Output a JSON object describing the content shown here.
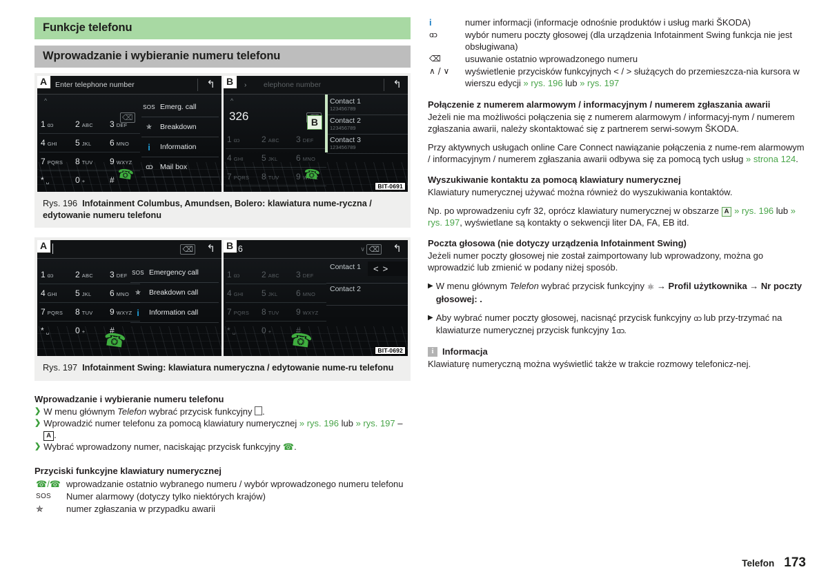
{
  "headers": {
    "green": "Funkcje telefonu",
    "grey": "Wprowadzanie i wybieranie numeru telefonu"
  },
  "figure196": {
    "tagA": "A",
    "tagB": "B",
    "tagB_inner": "B",
    "bit": "BIT-0691",
    "caption_rys": "Rys. 196",
    "caption_text": "Infotainment Columbus, Amundsen, Bolero: klawiatura nume-ryczna / edytowanie numeru telefonu",
    "screenA": {
      "title": "Enter telephone number",
      "keys": [
        {
          "digit": "1",
          "sub": "ɑɔ"
        },
        {
          "digit": "2",
          "sub": "ABC"
        },
        {
          "digit": "3",
          "sub": "DEF"
        },
        {
          "digit": "4",
          "sub": "GHI"
        },
        {
          "digit": "5",
          "sub": "JKL"
        },
        {
          "digit": "6",
          "sub": "MNO"
        },
        {
          "digit": "7",
          "sub": "PQRS"
        },
        {
          "digit": "8",
          "sub": "TUV"
        },
        {
          "digit": "9",
          "sub": "WXYZ"
        },
        {
          "digit": "*",
          "sub": "␣"
        },
        {
          "digit": "0",
          "sub": "+"
        },
        {
          "digit": "#",
          "sub": ""
        }
      ],
      "menu": [
        {
          "icon": "sos-icon",
          "glyph": "SOS",
          "label": "Emerg. call"
        },
        {
          "icon": "wrench-icon",
          "glyph": "🔧",
          "label": "Breakdown"
        },
        {
          "icon": "info-icon",
          "glyph": "i",
          "label": "Information"
        },
        {
          "icon": "voicemail-icon",
          "glyph": "ɑɔ",
          "label": "Mail box"
        }
      ]
    },
    "screenB": {
      "title": "elephone number",
      "number": "326",
      "contacts": [
        {
          "name": "Contact 1",
          "number": "123456789"
        },
        {
          "name": "Contact 2",
          "number": "123456789"
        },
        {
          "name": "Contact 3",
          "number": "123456789"
        }
      ]
    }
  },
  "figure197": {
    "tagA": "A",
    "tagB": "B",
    "bit": "BIT-0692",
    "caption_rys": "Rys. 197",
    "caption_text": "Infotainment Swing: klawiatura numeryczna / edytowanie nume-ru telefonu",
    "screenA": {
      "title": "",
      "menu": [
        {
          "icon": "sos-icon",
          "glyph": "SOS",
          "label": "Emergency call"
        },
        {
          "icon": "wrench-icon",
          "glyph": "🔧",
          "label": "Breakdown call"
        },
        {
          "icon": "info-icon",
          "glyph": "i",
          "label": "Information call"
        }
      ],
      "keys": [
        {
          "digit": "1",
          "sub": "ɑɔ"
        },
        {
          "digit": "2",
          "sub": "ABC"
        },
        {
          "digit": "3",
          "sub": "DEF"
        },
        {
          "digit": "4",
          "sub": "GHI"
        },
        {
          "digit": "5",
          "sub": "JKL"
        },
        {
          "digit": "6",
          "sub": "MNO"
        },
        {
          "digit": "7",
          "sub": "PQRS"
        },
        {
          "digit": "8",
          "sub": "TUV"
        },
        {
          "digit": "9",
          "sub": "WXYZ"
        },
        {
          "digit": "*",
          "sub": "␣"
        },
        {
          "digit": "0",
          "sub": "+"
        },
        {
          "digit": "#",
          "sub": ""
        }
      ]
    },
    "screenB": {
      "number": "326",
      "contacts": [
        {
          "name": "Contact 1"
        },
        {
          "name": "Contact 2"
        }
      ],
      "nav_prev": "<",
      "nav_next": ">"
    }
  },
  "left_sections": {
    "s1_title": "Wprowadzanie i wybieranie numeru telefonu",
    "s1_items": [
      {
        "pre": "W menu głównym ",
        "it": "Telefon",
        "post": " wybrać przycisk funkcyjny ",
        "tail": "."
      },
      {
        "pre": "Wprowadzić numer telefonu za pomocą klawiatury numerycznej ",
        "ref1": "» rys. 196",
        "mid": " lub ",
        "ref2": "» rys. 197",
        "post": " – ",
        "boxa": "A",
        "tail": "."
      },
      {
        "pre": "Wybrać wprowadzony numer, naciskając przycisk funkcyjny ",
        "tail": "."
      }
    ],
    "s2_title": "Przyciski funkcyjne klawiatury numerycznej",
    "s2_defs": [
      {
        "icon": "phone-pair-icon",
        "glyph": "✆/✆",
        "text": "wprowadzanie ostatnio wybranego numeru / wybór wprowadzonego numeru telefonu"
      },
      {
        "icon": "sos-icon",
        "glyph": "SOS",
        "text": "Numer alarmowy (dotyczy tylko niektórych krajów)"
      },
      {
        "icon": "wrench-icon",
        "glyph": "🔧",
        "text": "numer zgłaszania w przypadku awarii"
      }
    ]
  },
  "right_sections": {
    "defs_top": [
      {
        "icon": "info-icon",
        "glyph": "i",
        "text": "numer informacji (informacje odnośnie produktów i usług marki ŠKODA)"
      },
      {
        "icon": "voicemail-icon",
        "glyph": "ɑɔ",
        "text": "wybór numeru poczty głosowej (dla urządzenia Infotainment Swing funkcja nie jest obsługiwana)"
      },
      {
        "icon": "backspace-icon",
        "glyph": "⌫",
        "text": "usuwanie ostatnio wprowadzonego numeru"
      },
      {
        "icon": "chevron-up-down-icon",
        "glyph": "∧ / ∨",
        "text": "wyświetlenie przycisków funkcyjnych < / > służących do przemieszcza-nia kursora w wierszu edycji ",
        "ref1": "» rys. 196",
        "mid": " lub ",
        "ref2": "» rys. 197"
      }
    ],
    "s1_title": "Połączenie z numerem alarmowym / informacyjnym / numerem zgłaszania awarii",
    "s1_p1": "Jeżeli nie ma możliwości połączenia się z numerem alarmowym / informacyj-nym / numerem zgłaszania awarii, należy skontaktować się z partnerem serwi-sowym ŠKODA.",
    "s1_p2_pre": "Przy aktywnych usługach online Care Connect nawiązanie połączenia z nume-rem alarmowym / informacyjnym / numerem zgłaszania awarii odbywa się za pomocą tych usług ",
    "s1_p2_ref": "» strona 124",
    "s1_p2_tail": ".",
    "s2_title": "Wyszukiwanie kontaktu za pomocą klawiatury numerycznej",
    "s2_p1": "Klawiatury numerycznej używać można również do wyszukiwania kontaktów.",
    "s2_p2_pre": "Np. po wprowadzeniu cyfr 32, oprócz klawiatury numerycznej w obszarze ",
    "s2_p2_boxa": "A",
    "s2_p2_ref1": "» rys. 196",
    "s2_p2_mid": " lub ",
    "s2_p2_ref2": "» rys. 197",
    "s2_p2_tail": ", wyświetlane są kontakty o sekwencji liter DA, FA, EB itd.",
    "s3_title": "Poczta głosowa (nie dotyczy urządzenia Infotainment Swing)",
    "s3_p1": "Jeżeli numer poczty głosowej nie został zaimportowany lub wprowadzony, można go wprowadzić lub zmienić w podany niżej sposób.",
    "s3_b1_pre": "W menu głównym ",
    "s3_b1_it": "Telefon",
    "s3_b1_post": " wybrać przycisk funkcyjny ",
    "s3_b1_path": " → Profil użytkownika → Nr poczty głosowej: .",
    "s3_b2_pre": "Aby wybrać numer poczty głosowej, nacisnąć przycisk funkcyjny ",
    "s3_b2_mid": " lub przy-trzymać na klawiaturze numerycznej przycisk funkcyjny 1",
    "s3_b2_tail": ".",
    "note_title": "Informacja",
    "note_body": "Klawiaturę numeryczną można wyświetlić także w trakcie rozmowy telefonicz-nej."
  },
  "footer": {
    "section": "Telefon",
    "page": "173"
  },
  "colors": {
    "green_header": "#a8d9a3",
    "grey_header": "#bdbdbd",
    "ref_green": "#4aa54a",
    "screen_black": "#0b0d0f",
    "figure_bg": "#efefee"
  }
}
